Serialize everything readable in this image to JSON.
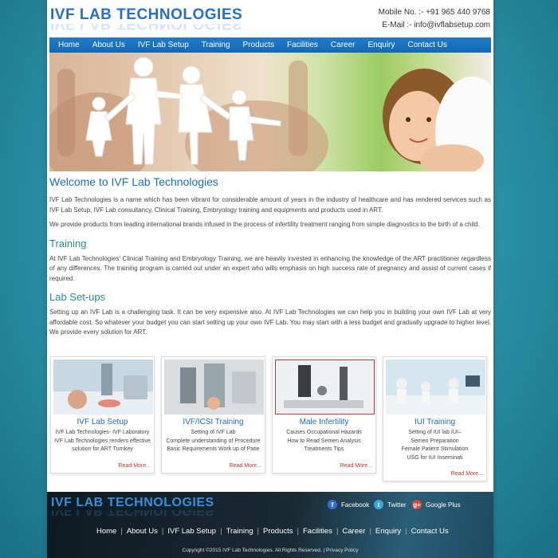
{
  "header": {
    "logo": "IVF LAB  TECHNOLOGIES",
    "mobile": "Mobile No. :- +91 965 440 9768",
    "email": "E-Mail :- info@ivflabsetup.com"
  },
  "nav": [
    "Home",
    "About Us",
    "IVF Lab Setup",
    "Training",
    "Products",
    "Facilities",
    "Career",
    "Enquiry",
    "Contact Us"
  ],
  "content": {
    "welcome_title": "Welcome to IVF Lab Technologies",
    "welcome_p1": "IVF Lab Technologies is a name which has been vibrant for considerable amount of years in the industry of healthcare and has rendered services such as IVF Lab Setup, IVF Lab consultancy, Clinical Training, Embryology training and equipments and products used in ART.",
    "welcome_p2": "We provide products from leading international brands infused in the process of infertility treatment ranging from simple diagnostics to the birth of a child.",
    "training_title": "Training",
    "training_p": "At IVF Lab Technologies' Clinical Training and Embryology Training, we are heavily invested in enhancing the knowledge of the ART practitioner regardless of any differences. The training program is carried out under an expert who wills emphasis on high success rate of pregnancy and assist of current cases if required.",
    "labsetup_title": "Lab Set-ups",
    "labsetup_p": "Setting up an IVF Lab is a challenging task. It can be very expensive also. At IVF Lab Technologies we can help you in building your own IVF Lab at very affordable cost. So whatever your budget you can start setting up your own IVF Lab. You may start with a less budget and gradually upgrade to higher level. We provide every solution for ART."
  },
  "cards": [
    {
      "title": "IVF Lab Setup",
      "lines": [
        "IVF Lab Technologies- IVF Laboratory",
        "IVF Lab Technologies renders effective",
        "solution for ART Turnkey"
      ],
      "more": "Read More..."
    },
    {
      "title": "IVF/ICSI Training",
      "lines": [
        "Setting of IVF Lab",
        "Complete understanding of Procedure",
        "Basic Requirements Work up of Patie"
      ],
      "more": "Read More..."
    },
    {
      "title": "Male Infertility",
      "lines": [
        "Causes Occupational Hazards",
        "How to Read Semen Analysis",
        "Treatments Tips"
      ],
      "more": "Read More..."
    },
    {
      "title": "IUI Training",
      "lines": [
        "Setting of IUI lab IUI–",
        "Semen Preparation",
        "Female Patient Stimulation",
        "USG for IUI Inseminati"
      ],
      "more": "Read More..."
    }
  ],
  "footer": {
    "logo": "IVF LAB  TECHNOLOGIES",
    "social": [
      {
        "label": "Facebook",
        "icon": "f"
      },
      {
        "label": "Twitter",
        "icon": "t"
      },
      {
        "label": "Google Plus",
        "icon": "g+"
      }
    ],
    "nav": [
      "Home",
      "About Us",
      "IVF Lab Setup",
      "Training",
      "Products",
      "Facilities",
      "Career",
      "Enquiry",
      "Contact Us"
    ],
    "copyright": "Copyright ©2015 IVF Lab Technologies. All Rights Reserved.",
    "privacy": "Privacy Policy"
  },
  "colors": {
    "accent": "#1b6fb6",
    "nav_bg": "#1567b3",
    "section": "#2a8b8b",
    "read_more": "#c0392b"
  }
}
